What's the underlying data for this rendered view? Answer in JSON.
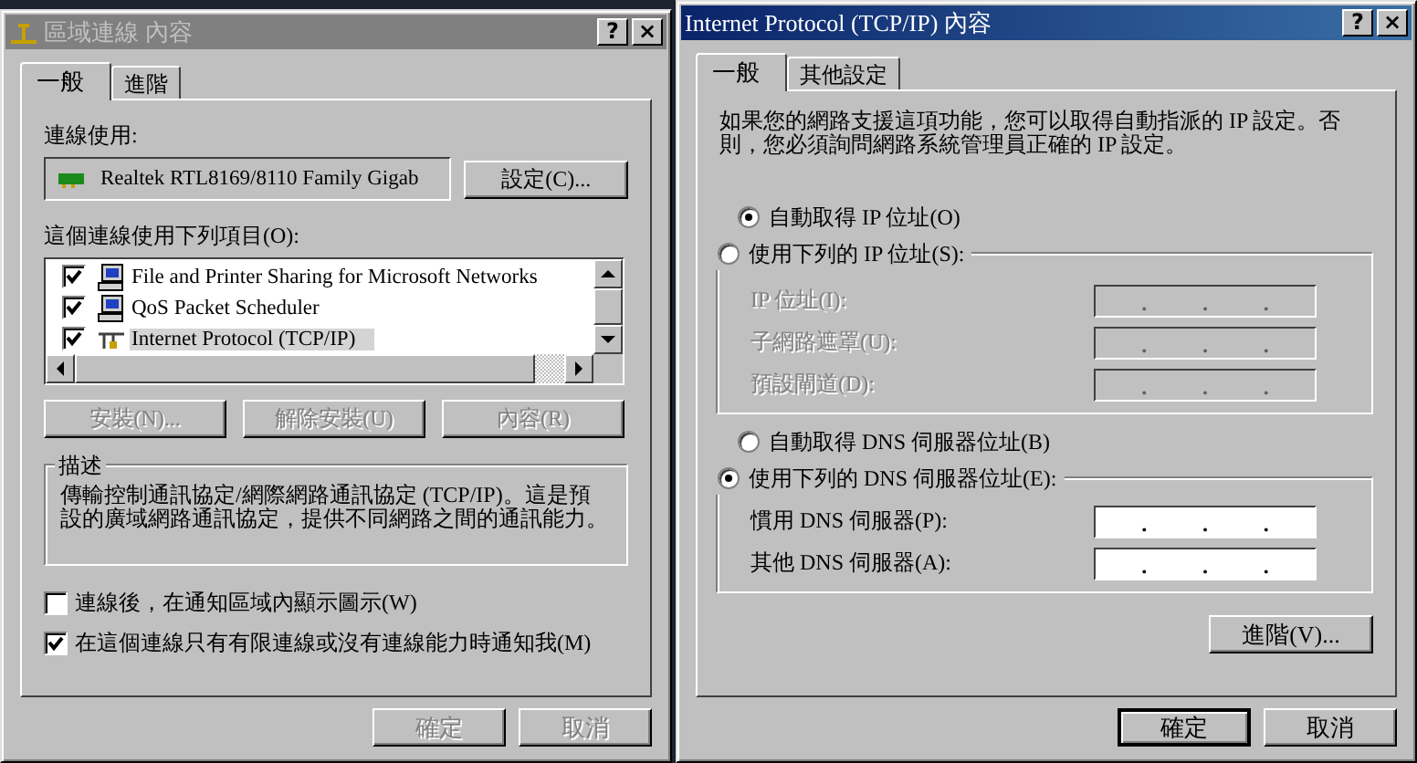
{
  "left_window": {
    "title": "區域連線 內容",
    "active": false,
    "title_buttons": [
      "?",
      "×"
    ],
    "tabs": [
      {
        "label": "一般",
        "selected": true
      },
      {
        "label": "進階",
        "selected": false
      }
    ],
    "connect_using_label": "連線使用:",
    "adapter_name": "Realtek RTL8169/8110 Family Gigab",
    "configure_button": "設定(C)...",
    "items_label": "這個連線使用下列項目(O):",
    "items": [
      {
        "label": "File and Printer Sharing for Microsoft Networks",
        "checked": true,
        "selected": false,
        "kind": "service"
      },
      {
        "label": "QoS Packet Scheduler",
        "checked": true,
        "selected": false,
        "kind": "service"
      },
      {
        "label": "Internet Protocol (TCP/IP)",
        "checked": true,
        "selected": true,
        "kind": "protocol"
      }
    ],
    "item_buttons": [
      {
        "label": "安裝(N)...",
        "disabled": true
      },
      {
        "label": "解除安裝(U)",
        "disabled": true
      },
      {
        "label": "內容(R)",
        "disabled": true
      }
    ],
    "description_title": "描述",
    "description": "傳輸控制通訊協定/網際網路通訊協定 (TCP/IP)。這是預設的廣域網路通訊協定，提供不同網路之間的通訊能力。",
    "options": [
      {
        "label": "連線後，在通知區域內顯示圖示(W)",
        "checked": false
      },
      {
        "label": "在這個連線只有有限連線或沒有連線能力時通知我(M)",
        "checked": true
      }
    ],
    "footer_buttons": [
      {
        "label": "確定",
        "disabled": true
      },
      {
        "label": "取消",
        "disabled": true
      }
    ]
  },
  "right_window": {
    "title": "Internet Protocol (TCP/IP) 內容",
    "active": true,
    "title_buttons": [
      "?",
      "×"
    ],
    "tabs": [
      {
        "label": "一般",
        "selected": true
      },
      {
        "label": "其他設定",
        "selected": false
      }
    ],
    "intro": "如果您的網路支援這項功能，您可以取得自動指派的 IP 設定。否則，您必須詢問網路系統管理員正確的 IP 設定。",
    "ip_auto": {
      "label": "自動取得 IP 位址(O)",
      "selected": true
    },
    "ip_manual": {
      "label": "使用下列的 IP 位址(S):",
      "selected": false
    },
    "ip_fields": [
      {
        "label": "IP 位址(I):",
        "disabled": true,
        "separators": [
          ".",
          ".",
          "."
        ]
      },
      {
        "label": "子網路遮罩(U):",
        "disabled": true,
        "separators": [
          ".",
          ".",
          "."
        ]
      },
      {
        "label": "預設閘道(D):",
        "disabled": true,
        "separators": [
          ".",
          ".",
          "."
        ]
      }
    ],
    "dns_auto": {
      "label": "自動取得 DNS 伺服器位址(B)",
      "selected": false
    },
    "dns_manual": {
      "label": "使用下列的 DNS 伺服器位址(E):",
      "selected": true
    },
    "dns_fields": [
      {
        "label": "慣用 DNS 伺服器(P):",
        "disabled": false,
        "separators": [
          ".",
          ".",
          "."
        ]
      },
      {
        "label": "其他 DNS 伺服器(A):",
        "disabled": false,
        "separators": [
          ".",
          ".",
          "."
        ]
      }
    ],
    "advanced_button": "進階(V)...",
    "footer_buttons": [
      {
        "label": "確定",
        "disabled": false
      },
      {
        "label": "取消",
        "disabled": false
      }
    ]
  }
}
